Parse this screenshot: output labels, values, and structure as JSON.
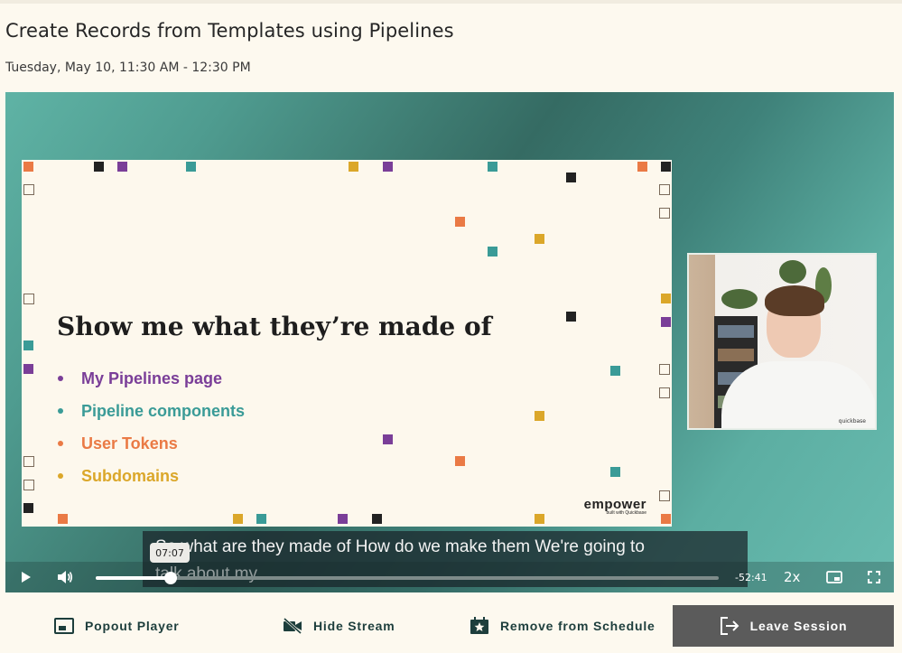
{
  "session": {
    "title": "Create Records from Templates using Pipelines",
    "datetime": "Tuesday, May 10, 11:30 AM - 12:30 PM"
  },
  "slide": {
    "heading": "Show me what they’re made of",
    "bullets": [
      {
        "text": "My Pipelines page",
        "color": "#7a3e98"
      },
      {
        "text": "Pipeline components",
        "color": "#3a9b97"
      },
      {
        "text": "User Tokens",
        "color": "#ea7a45"
      },
      {
        "text": "Subdomains",
        "color": "#dba72a"
      }
    ],
    "logo": "empower",
    "logo_sub": "built with Quickbase"
  },
  "camera": {
    "label": "quickbase"
  },
  "player": {
    "caption_line1": "So what are they made of How do we make them We're going to",
    "caption_line2": "talk about my",
    "current_time": "07:07",
    "remaining_time": "-52:41",
    "speed": "2x",
    "progress": 0.121
  },
  "actions": {
    "popout_label": "Popout Player",
    "hide_stream_label": "Hide Stream",
    "remove_label": "Remove from Schedule",
    "leave_label": "Leave Session"
  },
  "colors": {
    "teal": "#3a9b97",
    "purple": "#7a3e98",
    "orange": "#ea7a45",
    "gold": "#dba72a",
    "dark_button": "#5b5b5b"
  }
}
